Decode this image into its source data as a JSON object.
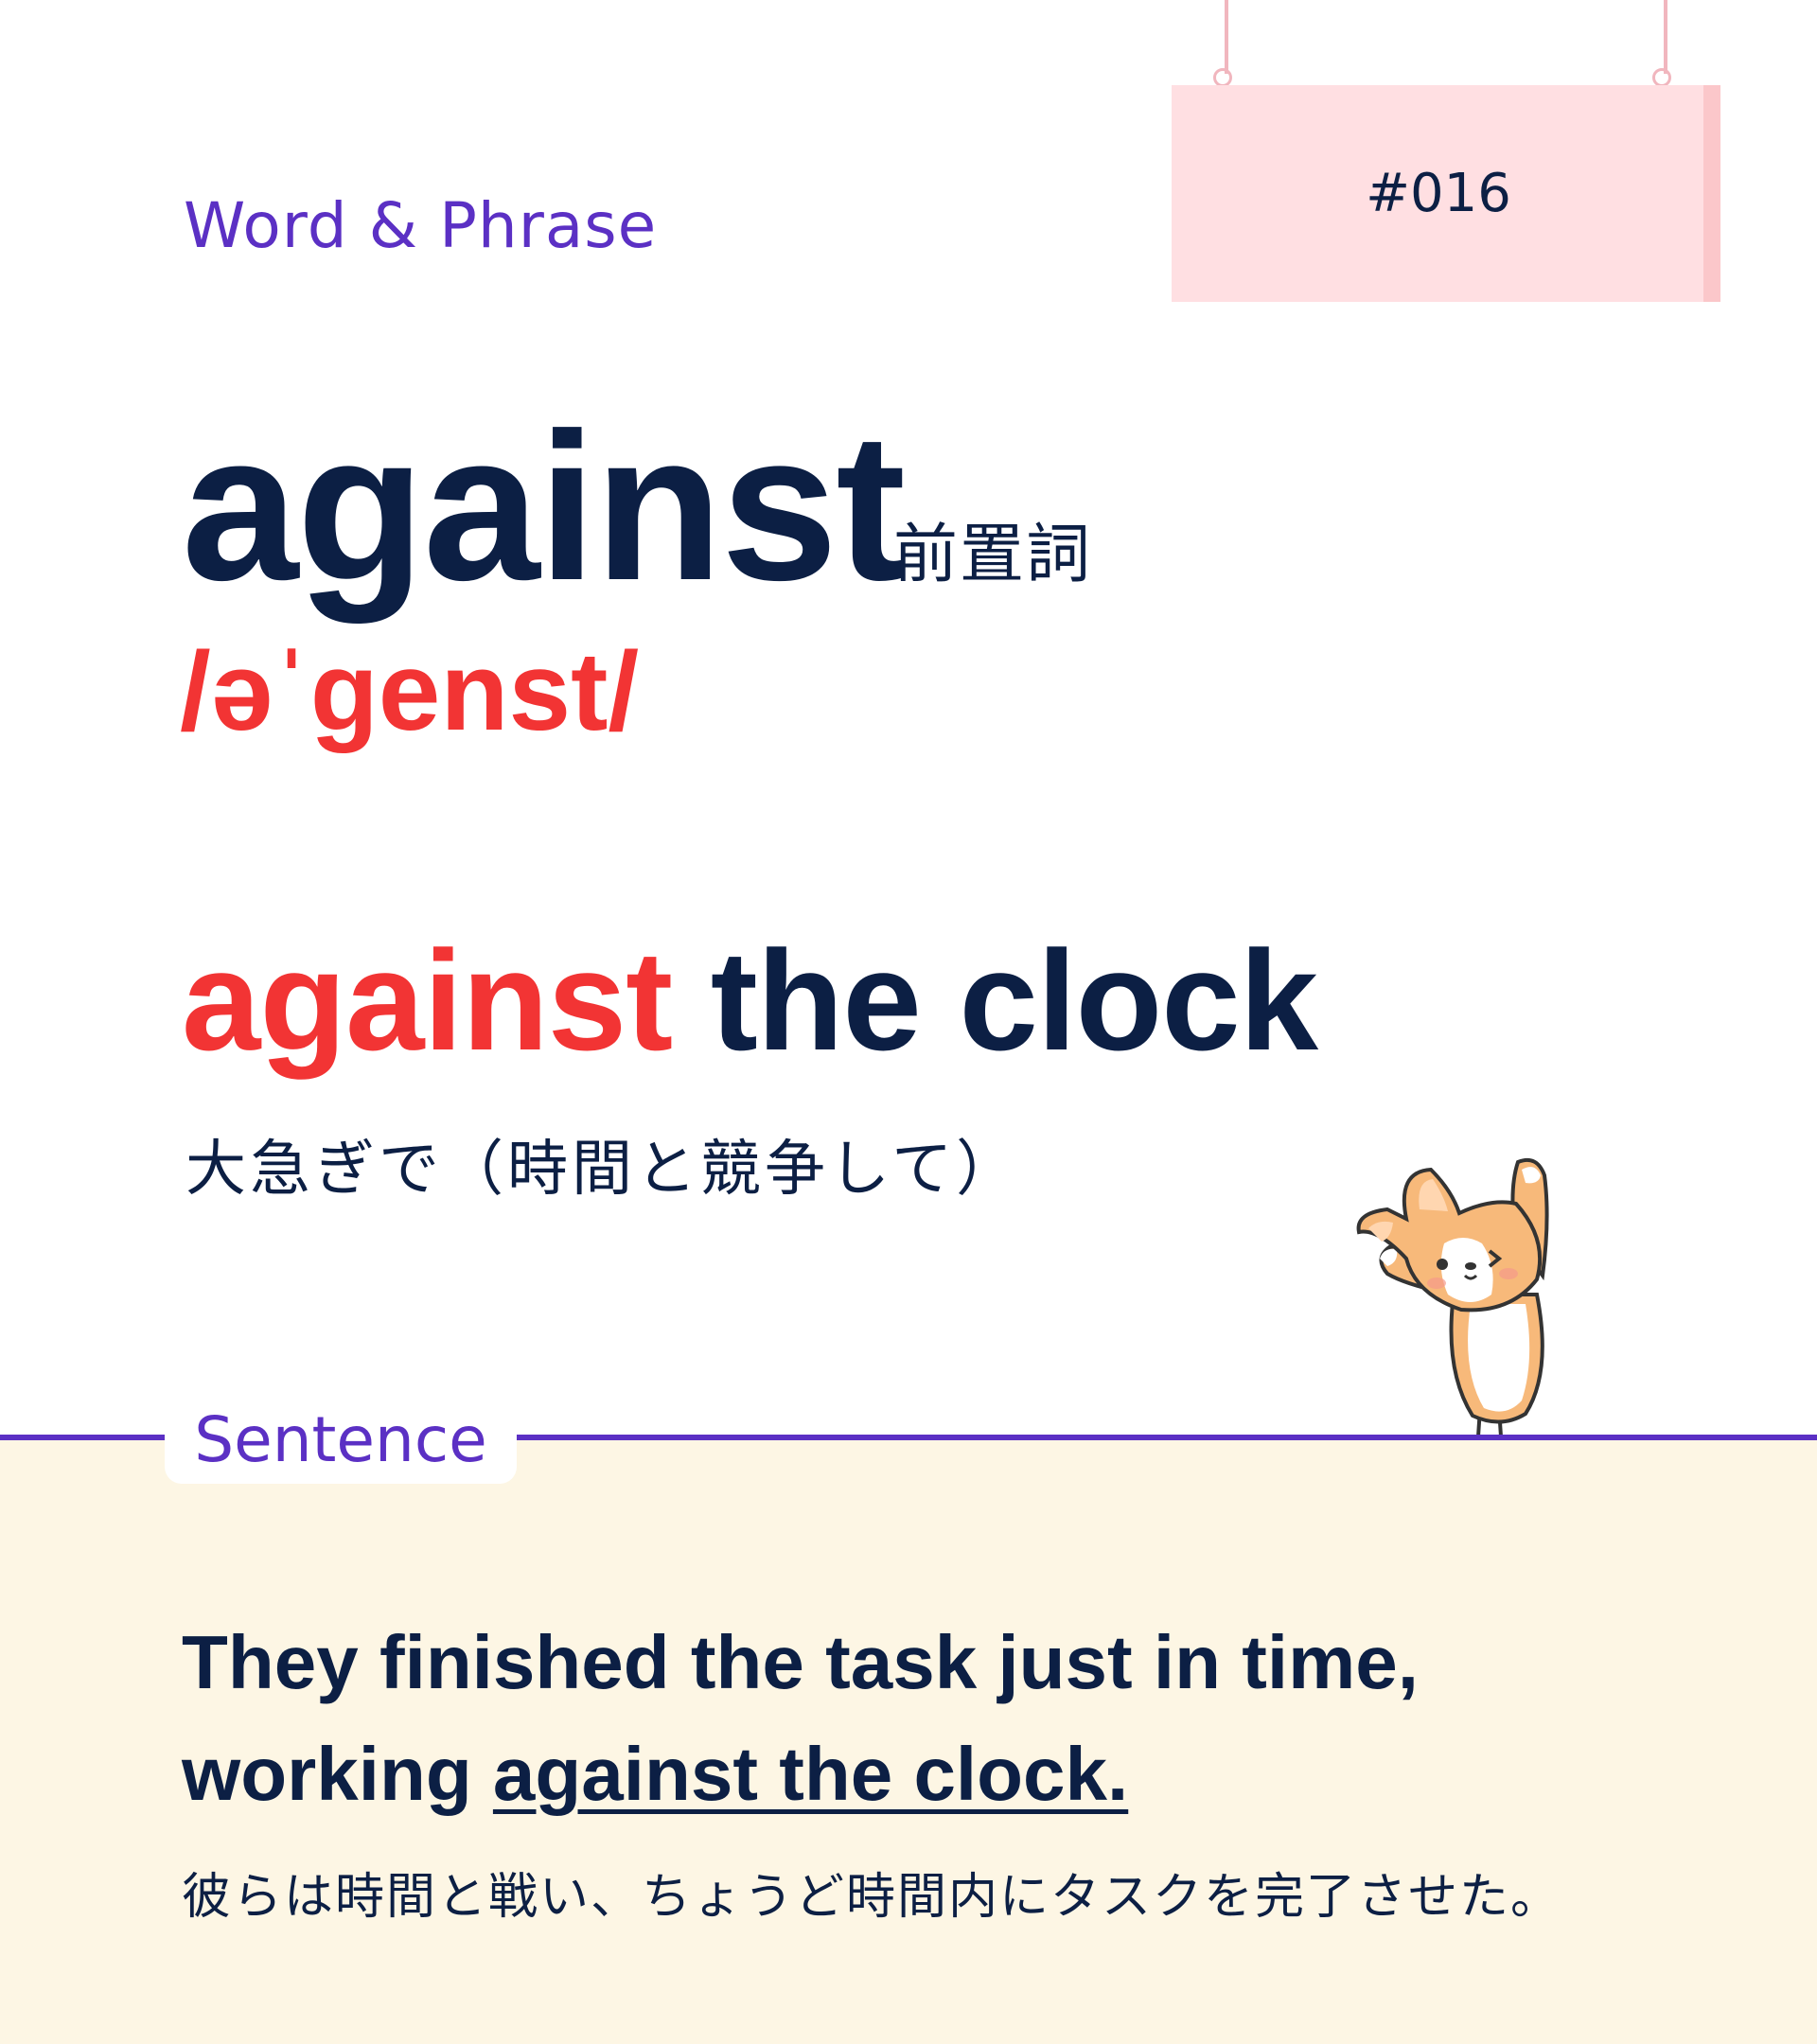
{
  "header": {
    "category": "Word & Phrase",
    "card_number": "#016"
  },
  "word": {
    "headword": "against",
    "part_of_speech": "前置詞",
    "pronunciation": "/əˈgenst/"
  },
  "phrase": {
    "highlight": "against",
    "rest": " the clock",
    "meaning_ja": "大急ぎで（時間と競争して）"
  },
  "sentence": {
    "label": "Sentence",
    "line1": "They finished the task just in time,",
    "line2_start": "working ",
    "line2_underlined": "against the clock.",
    "translation_ja": "彼らは時間と戦い、ちょうど時間内にタスクを完了させた。"
  },
  "illustration": {
    "icon": "corgi-dog-illustration"
  },
  "colors": {
    "accent_purple": "#5b30c4",
    "highlight_red": "#f23434",
    "text_navy": "#0c1f44",
    "sign_pink": "#ffdfe2",
    "sentence_bg": "#fdf6e4"
  }
}
